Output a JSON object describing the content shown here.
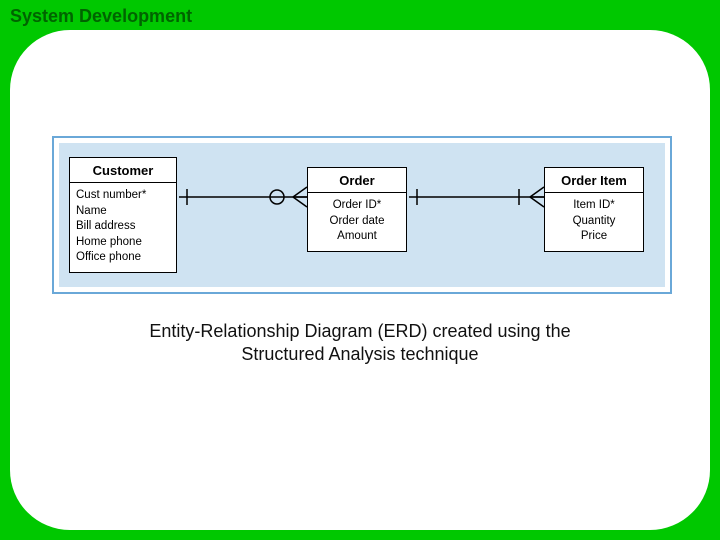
{
  "title": "System Development",
  "caption": "Entity-Relationship Diagram (ERD) created using the Structured Analysis technique",
  "entities": [
    {
      "name": "Customer",
      "attrs": [
        "Cust number*",
        "Name",
        "Bill address",
        "Home phone",
        "Office phone"
      ]
    },
    {
      "name": "Order",
      "attrs": [
        "Order ID*",
        "Order date",
        "Amount"
      ]
    },
    {
      "name": "Order Item",
      "attrs": [
        "Item ID*",
        "Quantity",
        "Price"
      ]
    }
  ],
  "relationships": [
    {
      "from": "Customer",
      "to": "Order",
      "from_card": "one",
      "to_card": "zero-or-many"
    },
    {
      "from": "Order",
      "to": "Order Item",
      "from_card": "one",
      "to_card": "one-or-many"
    }
  ]
}
